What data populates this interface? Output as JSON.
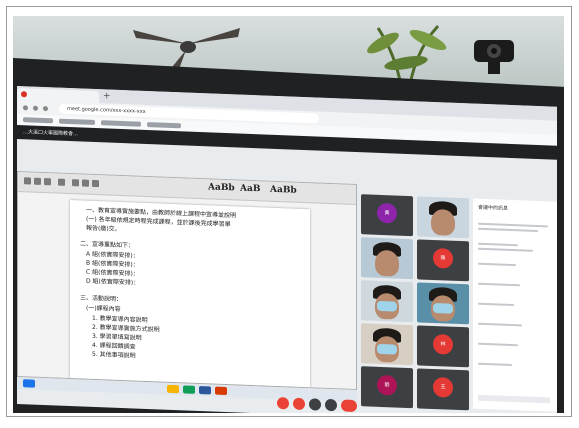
{
  "browser": {
    "url": "meet.google.com/xxx-xxxx-xxx",
    "tab_new": "+"
  },
  "meeting": {
    "title": "…大溪口火車國際教會…"
  },
  "document": {
    "style_samples": [
      "AaBb",
      "AaB",
      "AaBb"
    ],
    "lines": [
      "一、教育宣導實施要點，由教師於線上課程中宣導並說明",
      "(一) 各年級依規定時程完成課程，並於課後完成學習單",
      "報告(繳)交。",
      "二、宣導重點如下：",
      "A 組(依實際安排)：",
      "B 組(依實際安排)：",
      "C 組(依實際安排)：",
      "D 組(依實際安排)：",
      "三、活動說明：",
      "(一)課程內容",
      "1. 教學宣導內容說明",
      "2. 教學宣導實施方式說明",
      "3. 學習單填寫說明",
      "4. 課程回饋調查",
      "5. 其他事項說明"
    ]
  },
  "participants": [
    {
      "initial": "黃",
      "name": "",
      "kind": "avatar",
      "color": "#8e24aa"
    },
    {
      "initial": "",
      "name": "",
      "kind": "camera"
    },
    {
      "initial": "",
      "name": "",
      "kind": "camera"
    },
    {
      "initial": "陳",
      "name": "",
      "kind": "avatar",
      "color": "#e53935"
    },
    {
      "initial": "",
      "name": "",
      "kind": "camera"
    },
    {
      "initial": "",
      "name": "",
      "kind": "camera"
    },
    {
      "initial": "",
      "name": "",
      "kind": "camera"
    },
    {
      "initial": "林",
      "name": "",
      "kind": "avatar",
      "color": "#e53935"
    },
    {
      "initial": "劉",
      "name": "",
      "kind": "avatar",
      "color": "#ad1457"
    },
    {
      "initial": "王",
      "name": "",
      "kind": "avatar",
      "color": "#e53935"
    }
  ],
  "chat": {
    "title": "會議中的訊息",
    "messages": [
      "",
      "",
      "",
      "",
      "",
      ""
    ]
  },
  "colors": {
    "end_call": "#ea4335",
    "control": "#3c4043",
    "accent": "#1a73e8"
  }
}
